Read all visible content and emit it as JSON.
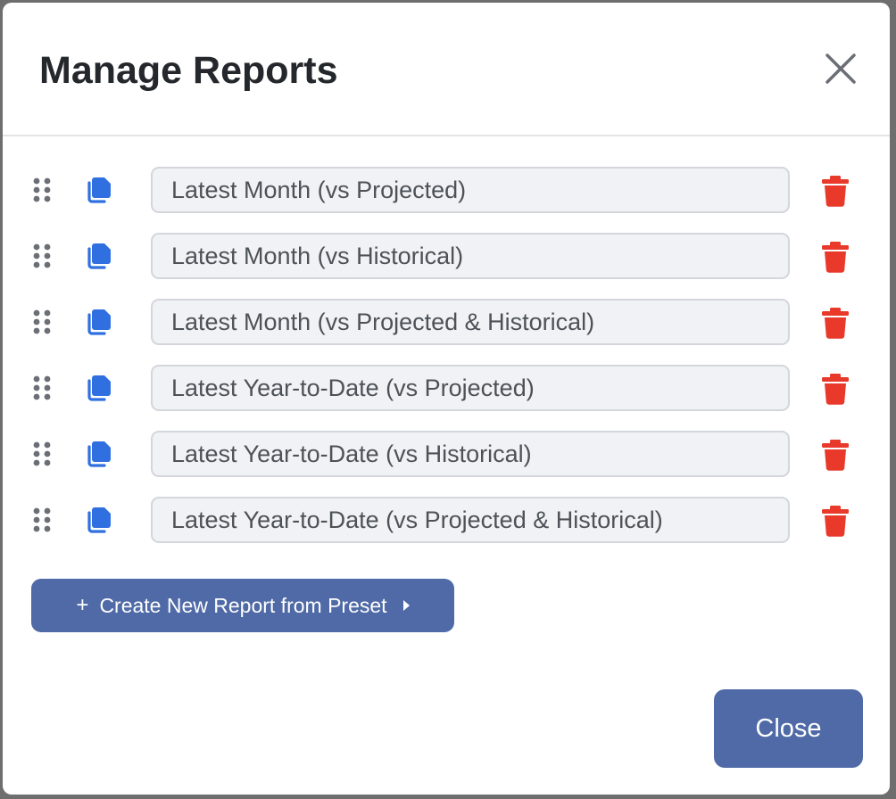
{
  "dialog": {
    "title": "Manage Reports"
  },
  "reports": [
    {
      "name": "Latest Month (vs Projected)"
    },
    {
      "name": "Latest Month (vs Historical)"
    },
    {
      "name": "Latest Month (vs Projected & Historical)"
    },
    {
      "name": "Latest Year-to-Date (vs Projected)"
    },
    {
      "name": "Latest Year-to-Date (vs Historical)"
    },
    {
      "name": "Latest Year-to-Date (vs Projected & Historical)"
    }
  ],
  "actions": {
    "create_plus": "+",
    "create_label": "Create New Report from Preset",
    "close_label": "Close"
  },
  "icons": {
    "close": "close-x-icon",
    "drag": "drag-handle-icon",
    "copy": "copy-icon",
    "delete": "trash-icon",
    "caret": "caret-right-icon"
  },
  "colors": {
    "accent": "#4f6aa6",
    "copy_icon": "#2f6fe0",
    "delete_icon": "#e8392a",
    "drag_icon": "#6b6f75"
  }
}
